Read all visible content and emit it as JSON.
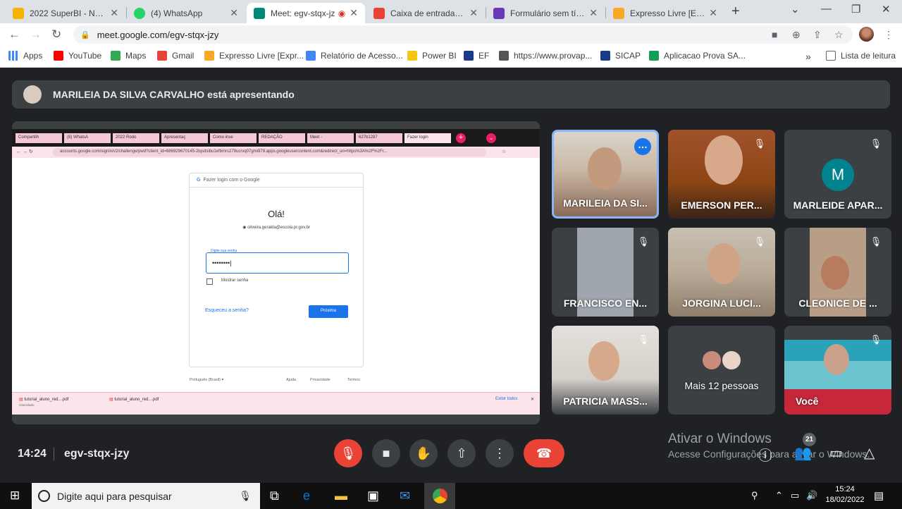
{
  "browser": {
    "tabs": [
      {
        "title": "2022 SuperBI - NRE -",
        "favicon_color": "#f4b400"
      },
      {
        "title": "(4) WhatsApp",
        "favicon_color": "#25d366"
      },
      {
        "title": "Meet: egv-stqx-jz",
        "favicon_color": "#00897b"
      },
      {
        "title": "Caixa de entrada (139",
        "favicon_color": "#ea4335"
      },
      {
        "title": "Formulário sem título",
        "favicon_color": "#673ab7"
      },
      {
        "title": "Expresso Livre [Expres",
        "favicon_color": "#f9a825"
      }
    ],
    "url": "meet.google.com/egv-stqx-jzy",
    "bookmarks": [
      {
        "label": "Apps",
        "icon": "apps-grid-icon",
        "color": "#4285f4"
      },
      {
        "label": "YouTube",
        "icon": "youtube-icon",
        "color": "#ff0000"
      },
      {
        "label": "Maps",
        "icon": "maps-icon",
        "color": "#34a853"
      },
      {
        "label": "Gmail",
        "icon": "gmail-icon",
        "color": "#ea4335"
      },
      {
        "label": "Expresso Livre [Expr...",
        "icon": "expresso-icon",
        "color": "#f9a825"
      },
      {
        "label": "Relatório de Acesso...",
        "icon": "report-icon",
        "color": "#4285f4"
      },
      {
        "label": "Power BI",
        "icon": "powerbi-icon",
        "color": "#f2c811"
      },
      {
        "label": "EF",
        "icon": "ef-icon",
        "color": "#1a3a8a"
      },
      {
        "label": "https://www.provap...",
        "icon": "page-icon",
        "color": "#555555"
      },
      {
        "label": "SICAP",
        "icon": "sicap-icon",
        "color": "#1a3a8a"
      },
      {
        "label": "Aplicacao Prova SA...",
        "icon": "sheets-icon",
        "color": "#0f9d58"
      }
    ],
    "reading_list": "Lista de leitura",
    "more_bookmarks": "»"
  },
  "meet": {
    "presenting": "MARILEIA DA SILVA CARVALHO está apresentando",
    "shared_screen": {
      "tabs": [
        "Compartilh",
        "(8) WhatsA",
        "2022 Rodo",
        "Apresentaç",
        "Como inse",
        "REDAÇÃO",
        "Meet -",
        "627b1287"
      ],
      "active_tab": "Fazer login",
      "url": "accounts.google.com/signin/v2/challenge/pwd?client_id=686929670145-2lqsdsibu1efbmrs279ucrvq07gmi979.apps.googleusercontent.com&redirect_uri=https%3A%2F%2Fr...",
      "card_header": "Fazer login com o Google",
      "greeting": "Olá!",
      "email": "oliveira.geralda@escola.pr.gov.br",
      "password_label": "Digite sua senha",
      "password_value": "••••••••|",
      "show_password": "Mostrar senha",
      "forgot": "Esqueceu a senha?",
      "next": "Próxima",
      "language": "Português (Brasil) ▾",
      "footer_links": [
        "Ajuda",
        "Privacidade",
        "Termos"
      ],
      "downloads": [
        {
          "name": "tutorial_aluno_red....pdf",
          "status": "Cancelado"
        },
        {
          "name": "tutorial_aluno_red....pdf",
          "status": ""
        }
      ],
      "show_all": "Exibir todos"
    },
    "participants": [
      {
        "name": "MARILEIA DA SI...",
        "muted": false
      },
      {
        "name": "EMERSON PER...",
        "muted": true
      },
      {
        "name": "MARLEIDE APAR...",
        "muted": true,
        "initial": "M"
      },
      {
        "name": "FRANCISCO EN...",
        "muted": true
      },
      {
        "name": "JORGINA LUCI...",
        "muted": true
      },
      {
        "name": "CLEONICE DE ...",
        "muted": true
      },
      {
        "name": "PATRICIA MASS...",
        "muted": true
      },
      {
        "name": "Mais 12 pessoas",
        "muted": false
      },
      {
        "name": "Você",
        "muted": true
      }
    ],
    "time": "14:24",
    "code": "egv-stqx-jzy",
    "people_count": "21",
    "watermark_title": "Ativar o Windows",
    "watermark_sub": "Acesse Configurações para ativar o Windows."
  },
  "taskbar": {
    "search_placeholder": "Digite aqui para pesquisar",
    "time": "15:24",
    "date": "18/02/2022"
  }
}
